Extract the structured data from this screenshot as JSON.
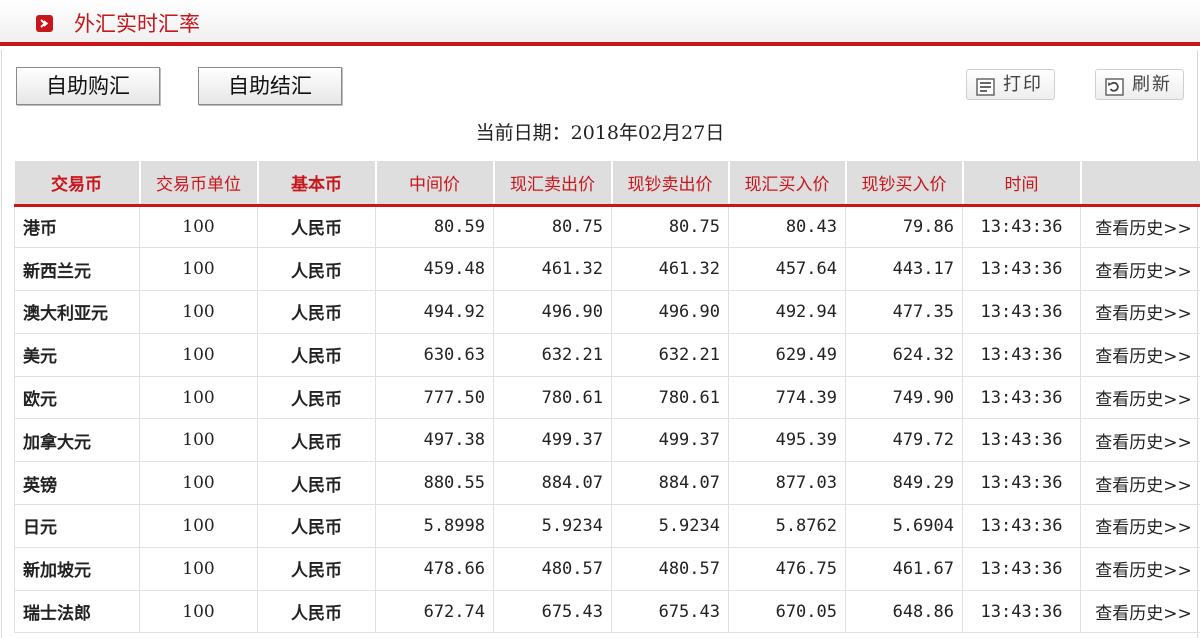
{
  "header": {
    "title": "外汇实时汇率"
  },
  "buttons": {
    "buy": "自助购汇",
    "settle": "自助结汇",
    "print": "打印",
    "refresh": "刷新"
  },
  "date": {
    "label": "当前日期：",
    "value": "2018年02月27日"
  },
  "columns": [
    "交易币",
    "交易币单位",
    "基本币",
    "中间价",
    "现汇卖出价",
    "现钞卖出价",
    "现汇买入价",
    "现钞买入价",
    "时间",
    ""
  ],
  "rows": [
    {
      "currency": "港币",
      "unit": "100",
      "base": "人民币",
      "mid": "80.59",
      "fx_sell": "80.75",
      "cash_sell": "80.75",
      "fx_buy": "80.43",
      "cash_buy": "79.86",
      "time": "13:43:36",
      "history": "查看历史>>"
    },
    {
      "currency": "新西兰元",
      "unit": "100",
      "base": "人民币",
      "mid": "459.48",
      "fx_sell": "461.32",
      "cash_sell": "461.32",
      "fx_buy": "457.64",
      "cash_buy": "443.17",
      "time": "13:43:36",
      "history": "查看历史>>"
    },
    {
      "currency": "澳大利亚元",
      "unit": "100",
      "base": "人民币",
      "mid": "494.92",
      "fx_sell": "496.90",
      "cash_sell": "496.90",
      "fx_buy": "492.94",
      "cash_buy": "477.35",
      "time": "13:43:36",
      "history": "查看历史>>"
    },
    {
      "currency": "美元",
      "unit": "100",
      "base": "人民币",
      "mid": "630.63",
      "fx_sell": "632.21",
      "cash_sell": "632.21",
      "fx_buy": "629.49",
      "cash_buy": "624.32",
      "time": "13:43:36",
      "history": "查看历史>>"
    },
    {
      "currency": "欧元",
      "unit": "100",
      "base": "人民币",
      "mid": "777.50",
      "fx_sell": "780.61",
      "cash_sell": "780.61",
      "fx_buy": "774.39",
      "cash_buy": "749.90",
      "time": "13:43:36",
      "history": "查看历史>>"
    },
    {
      "currency": "加拿大元",
      "unit": "100",
      "base": "人民币",
      "mid": "497.38",
      "fx_sell": "499.37",
      "cash_sell": "499.37",
      "fx_buy": "495.39",
      "cash_buy": "479.72",
      "time": "13:43:36",
      "history": "查看历史>>"
    },
    {
      "currency": "英镑",
      "unit": "100",
      "base": "人民币",
      "mid": "880.55",
      "fx_sell": "884.07",
      "cash_sell": "884.07",
      "fx_buy": "877.03",
      "cash_buy": "849.29",
      "time": "13:43:36",
      "history": "查看历史>>"
    },
    {
      "currency": "日元",
      "unit": "100",
      "base": "人民币",
      "mid": "5.8998",
      "fx_sell": "5.9234",
      "cash_sell": "5.9234",
      "fx_buy": "5.8762",
      "cash_buy": "5.6904",
      "time": "13:43:36",
      "history": "查看历史>>"
    },
    {
      "currency": "新加坡元",
      "unit": "100",
      "base": "人民币",
      "mid": "478.66",
      "fx_sell": "480.57",
      "cash_sell": "480.57",
      "fx_buy": "476.75",
      "cash_buy": "461.67",
      "time": "13:43:36",
      "history": "查看历史>>"
    },
    {
      "currency": "瑞士法郎",
      "unit": "100",
      "base": "人民币",
      "mid": "672.74",
      "fx_sell": "675.43",
      "cash_sell": "675.43",
      "fx_buy": "670.05",
      "cash_buy": "648.86",
      "time": "13:43:36",
      "history": "查看历史>>"
    }
  ],
  "icons": {
    "logo": "arrow-logo-icon",
    "print": "printer-icon",
    "refresh": "refresh-icon"
  },
  "colors": {
    "accent": "#c8161d",
    "header_bg": "#dedede"
  }
}
